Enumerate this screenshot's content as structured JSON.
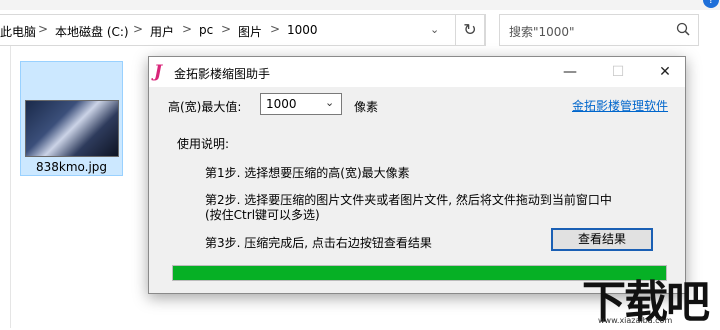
{
  "explorer": {
    "breadcrumbs": [
      "此电脑",
      "本地磁盘 (C:)",
      "用户",
      "pc",
      "图片",
      "1000"
    ],
    "breadcrumb_sep": ">",
    "search_placeholder": "搜索\"1000\"",
    "file": {
      "name": "838kmo.jpg"
    }
  },
  "dialog": {
    "title": "金拓影楼缩图助手",
    "app_icon_char": "J",
    "max_label": "高(宽)最大值:",
    "max_value": "1000",
    "unit": "像素",
    "link": "金拓影楼管理软件",
    "usage_title": "使用说明:",
    "step1": "第1步. 选择想要压缩的高(宽)最大像素",
    "step2_line1": "第2步. 选择要压缩的图片文件夹或者图片文件, 然后将文件拖动到当前窗口中",
    "step2_line2": "(按住Ctrl键可以多选)",
    "step3": "第3步. 压缩完成后, 点击右边按钮查看结果",
    "view_button": "查看结果",
    "progress": 1.0,
    "progress_color": "#06b025"
  },
  "watermark": {
    "main": "下载吧",
    "sub": "www.xiazaiba.com"
  }
}
